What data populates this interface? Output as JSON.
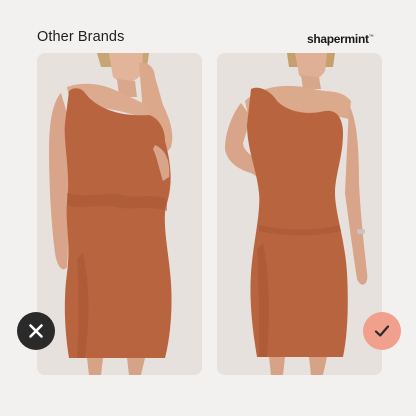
{
  "comparison": {
    "left": {
      "heading": "Other Brands",
      "verdict_icon": "cross-icon",
      "verdict_color": "#2a2a2a"
    },
    "right": {
      "brand_name": "shapermint",
      "brand_mark": "™",
      "verdict_icon": "check-icon",
      "verdict_color": "#f1a08d"
    }
  },
  "colors": {
    "background": "#f3f1ef",
    "card": "#e6e1dc",
    "dress": "#b8653f"
  }
}
